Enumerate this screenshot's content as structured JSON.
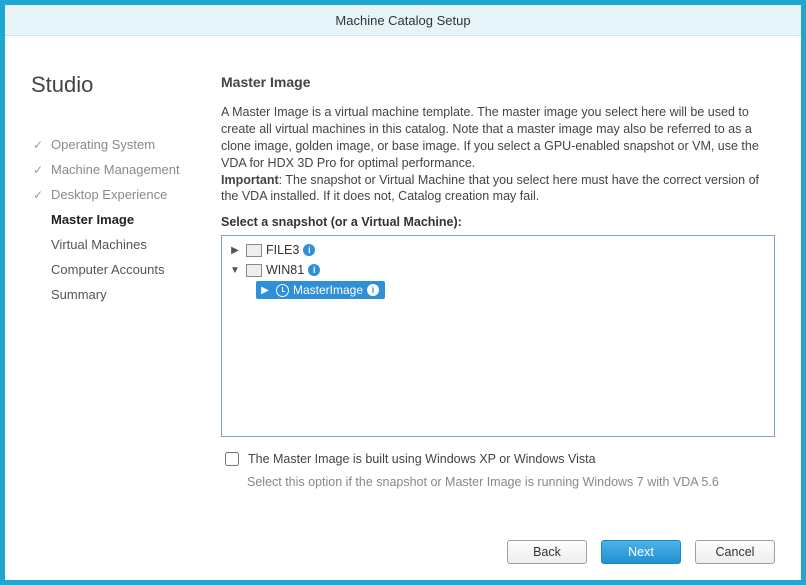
{
  "window": {
    "title": "Machine Catalog Setup"
  },
  "sidebar": {
    "brand": "Studio",
    "steps": [
      {
        "label": "Operating System",
        "state": "done"
      },
      {
        "label": "Machine Management",
        "state": "done"
      },
      {
        "label": "Desktop Experience",
        "state": "done"
      },
      {
        "label": "Master Image",
        "state": "active"
      },
      {
        "label": "Virtual Machines",
        "state": "future"
      },
      {
        "label": "Computer Accounts",
        "state": "future"
      },
      {
        "label": "Summary",
        "state": "future"
      }
    ]
  },
  "main": {
    "title": "Master Image",
    "description_part1": "A Master Image is a virtual machine template. The master image you select here will be used to create all virtual machines in this catalog. Note that a master image may also be referred to as a clone image, golden image, or base image. If you select a GPU-enabled snapshot or VM, use the VDA for HDX 3D Pro for optimal performance.",
    "important_label": "Important",
    "important_text": ": The snapshot or Virtual Machine that you select here must have the correct version of the VDA installed. If it does not, Catalog creation may fail.",
    "tree_label": "Select a snapshot (or a Virtual Machine):",
    "tree": {
      "nodes": [
        {
          "name": "FILE3",
          "expanded": false,
          "children": []
        },
        {
          "name": "WIN81",
          "expanded": true,
          "children": [
            {
              "name": "MasterImage",
              "selected": true
            }
          ]
        }
      ]
    },
    "checkbox_label": "The Master Image is built using Windows XP or Windows Vista",
    "checkbox_checked": false,
    "hint": "Select this option if the snapshot or Master Image is running Windows 7 with VDA 5.6"
  },
  "footer": {
    "back": "Back",
    "next": "Next",
    "cancel": "Cancel"
  }
}
